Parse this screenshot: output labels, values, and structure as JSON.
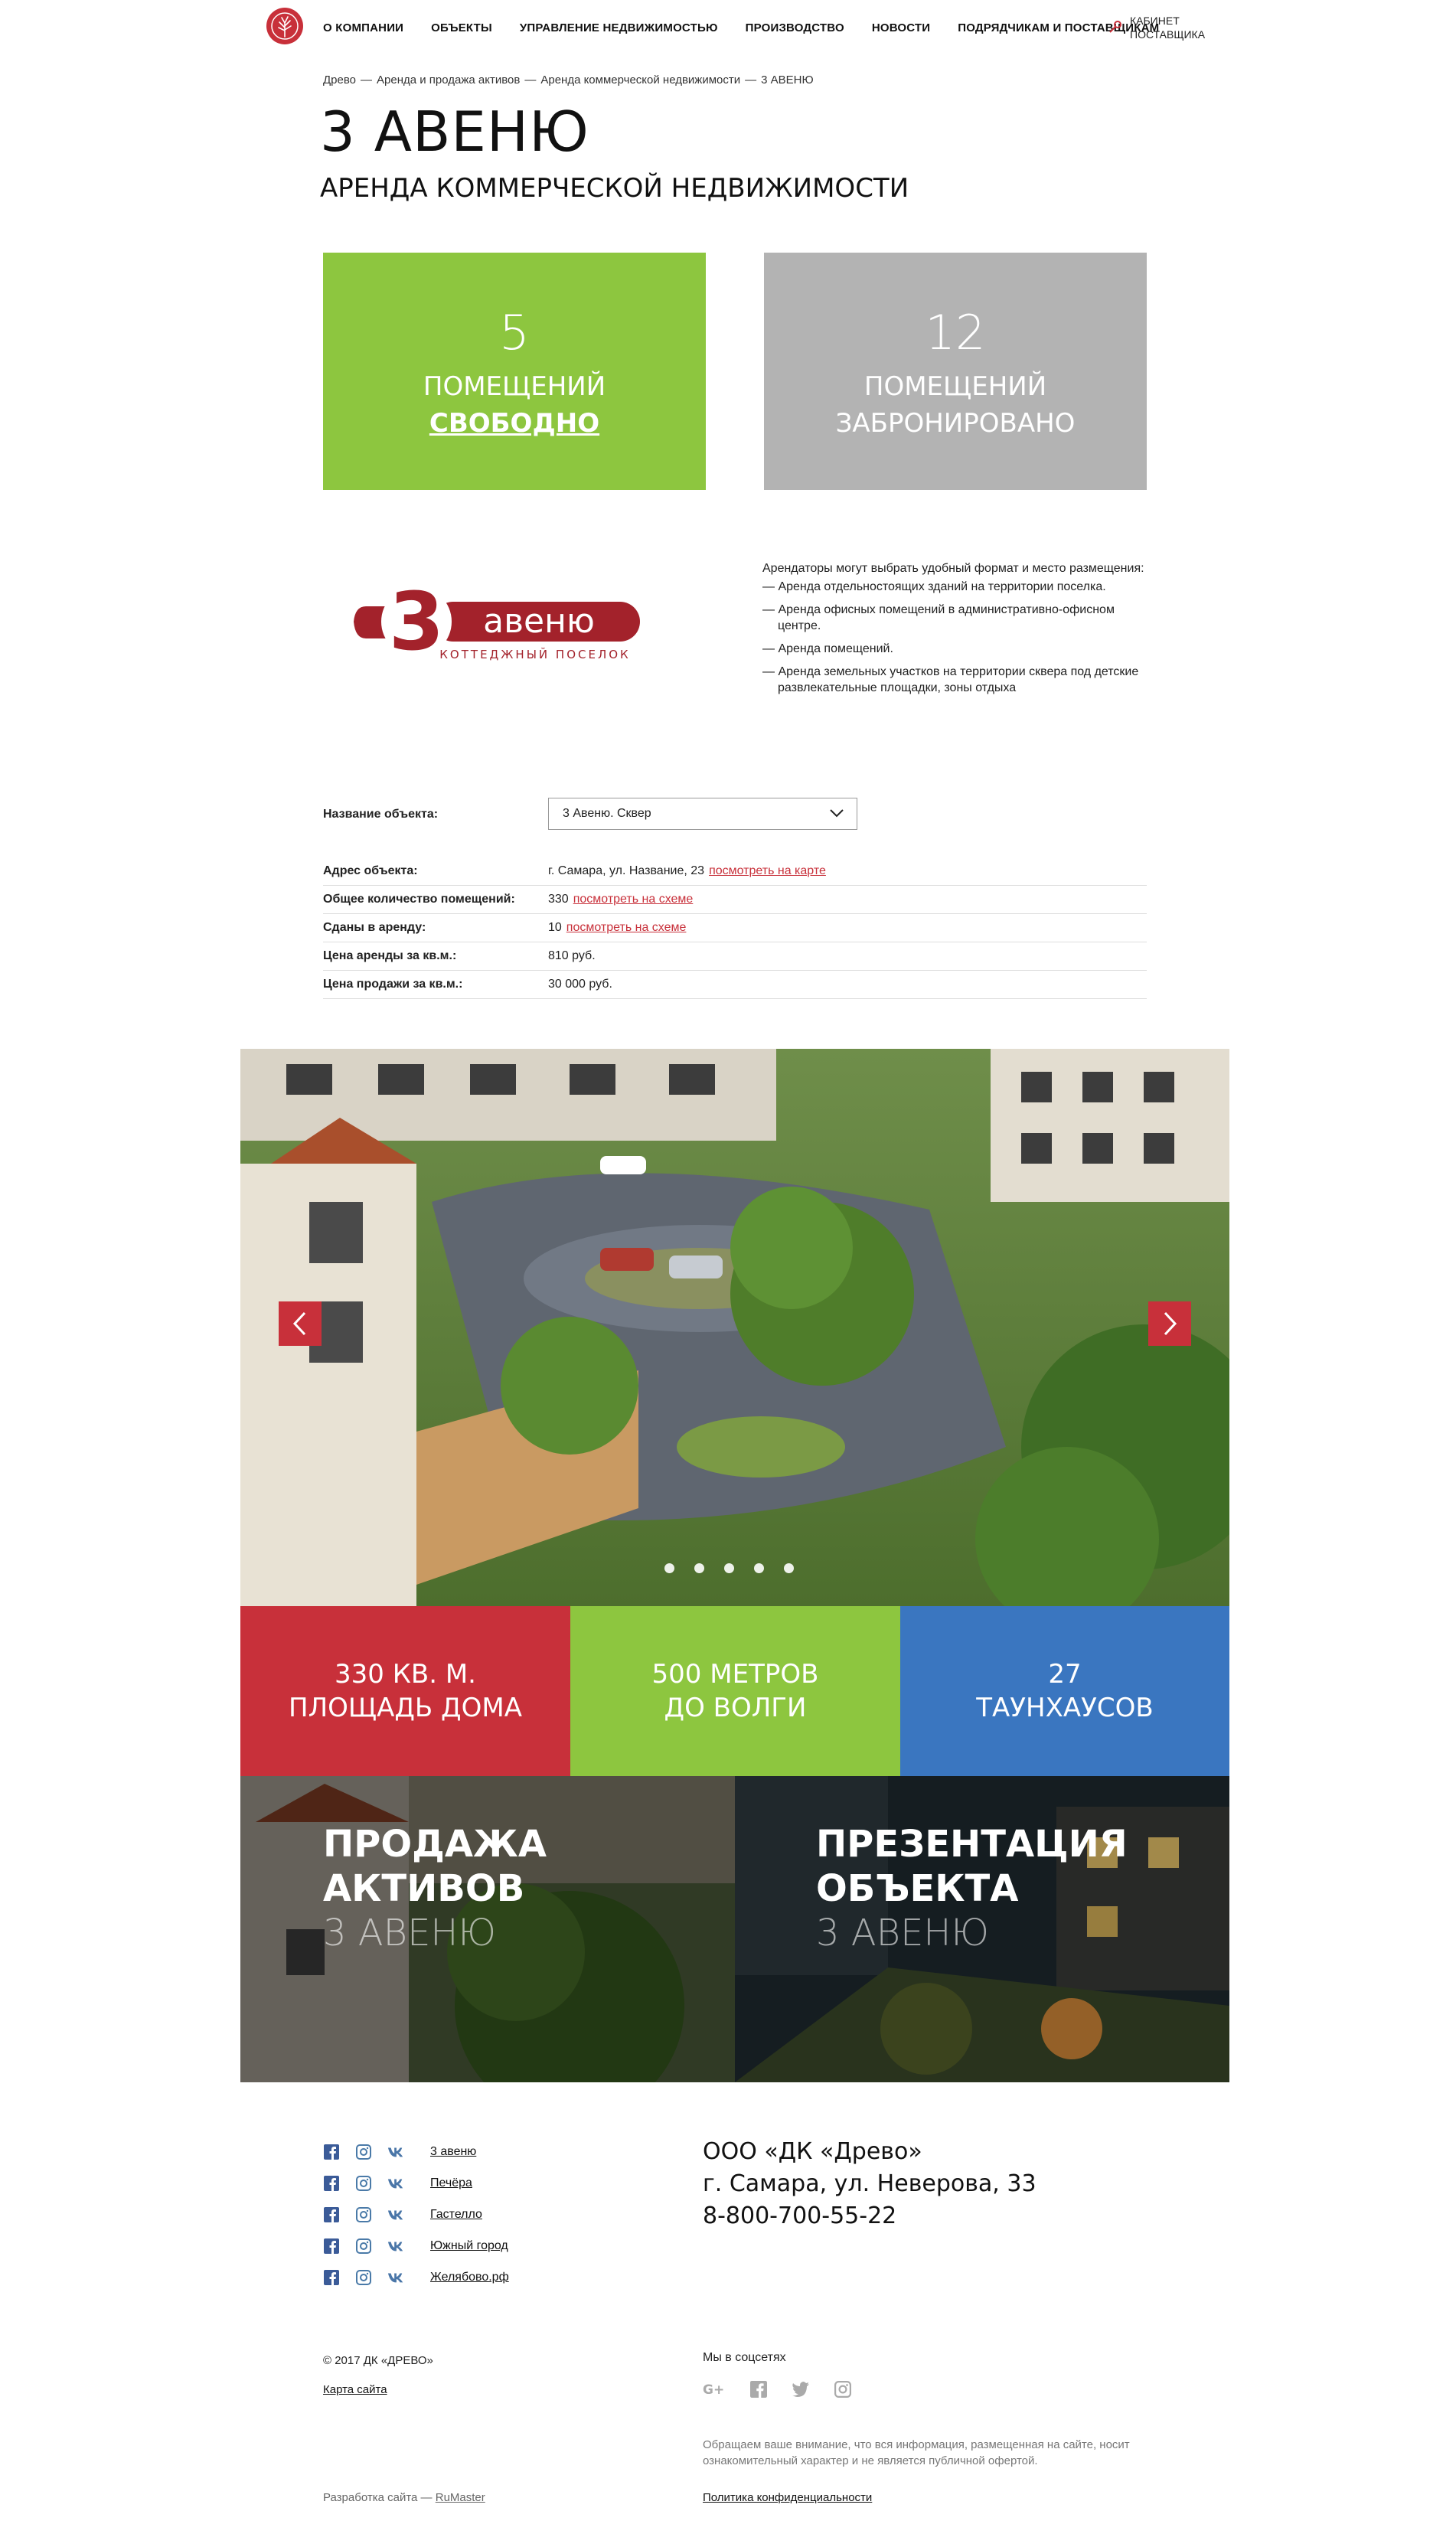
{
  "header": {
    "nav": [
      "О компании",
      "Объекты",
      "Управление недвижимостью",
      "Производство",
      "Новости",
      "Подрядчикам и поставщикам"
    ],
    "cabinet_line1": "Кабинет",
    "cabinet_line2": "поставщика"
  },
  "breadcrumb": {
    "items": [
      "Древо",
      "Аренда и продажа активов",
      "Аренда коммерческой недвижимости",
      "3 АВЕНЮ"
    ],
    "separator": "—"
  },
  "page": {
    "title": "3 АВЕНЮ",
    "subtitle": "АРЕНДА КОММЕРЧЕСКОЙ НЕДВИЖИМОСТИ"
  },
  "stats": {
    "free": {
      "number": "5",
      "line1": "помещений",
      "line2": "свободно",
      "color": "#8dc63f"
    },
    "reserved": {
      "number": "12",
      "line1": "помещений",
      "line2": "забронировано",
      "color": "#b3b3b3"
    }
  },
  "brand": {
    "logo_number": "3",
    "logo_word": "авеню",
    "logo_tagline": "КОТТЕДЖНЫЙ ПОСЕЛОК"
  },
  "description": {
    "intro": "Арендаторы могут выбрать удобный формат и место размещения:",
    "items": [
      "— Аренда отдельностоящих зданий на территории поселка.",
      "— Аренда офисных помещений в административно-офисном центре.",
      "— Аренда помещений.",
      "— Аренда земельных участков на территории сквера под детские развлекательные площадки, зоны отдыха"
    ]
  },
  "object_select": {
    "label": "Название объекта:",
    "value": "3 Авеню. Сквер"
  },
  "properties": [
    {
      "key": "Адрес объекта:",
      "value": "г. Самара, ул. Название, 23",
      "link": "посмотреть на карте"
    },
    {
      "key": "Общее количество помещений:",
      "value": "330",
      "link": "посмотреть на схеме"
    },
    {
      "key": "Сданы в аренду:",
      "value": "10",
      "link": "посмотреть на схеме"
    },
    {
      "key": "Цена аренды за кв.м.:",
      "value": "810 руб.",
      "link": ""
    },
    {
      "key": "Цена продажи за кв.м.:",
      "value": "30 000 руб.",
      "link": ""
    }
  ],
  "slider": {
    "dots": 5,
    "active_dot": 1
  },
  "tiles": [
    {
      "line1": "330 кв. м.",
      "line2": "площадь дома",
      "color": "#c8303a"
    },
    {
      "line1": "500 метров",
      "line2": "до Волги",
      "color": "#8dc63f"
    },
    {
      "line1": "27",
      "line2": "таунхаусов",
      "color": "#3a76c0"
    }
  ],
  "promos": [
    {
      "line1": "Продажа",
      "line2": "активов",
      "sub": "3 Авеню"
    },
    {
      "line1": "Презентация",
      "line2": "объекта",
      "sub": "3 Авеню"
    }
  ],
  "footer": {
    "projects": [
      "3 авеню",
      "Печёра",
      "Гастелло",
      "Южный город",
      "Желябово.рф"
    ],
    "company": "ООО «ДК «Древо»",
    "address": "г. Самара, ул. Неверова, 33",
    "phone": "8-800-700-55-22",
    "copyright": "© 2017 ДК «ДРЕВО»",
    "sitemap": "Карта сайта",
    "dev_prefix": "Разработка сайта —",
    "dev_name": "RuMaster",
    "socials_title": "Мы в соцсетях",
    "notice": "Обращаем ваше внимание, что вся информация, размещенная на сайте, носит ознакомительный характер и не является публичной офертой.",
    "privacy": "Политика конфиденциальности"
  },
  "colors": {
    "accent_red": "#c8303a",
    "green": "#8dc63f",
    "blue": "#3a76c0",
    "grey": "#b3b3b3"
  }
}
